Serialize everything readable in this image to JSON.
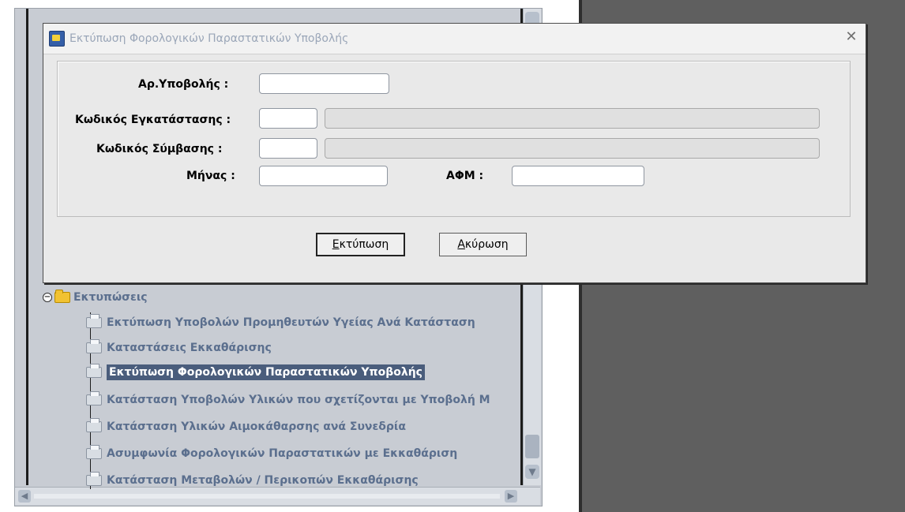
{
  "dialog": {
    "title": "Εκτύπωση Φορολογικών Παραστατικών Υποβολής",
    "close": "✕",
    "fields": {
      "submission_no_label": "Αρ.Υποβολής :",
      "installation_code_label": "Κωδικός Εγκατάστασης :",
      "contract_code_label": "Κωδικός Σύμβασης :",
      "month_label": "Μήνας :",
      "afm_label": "ΑΦΜ :"
    },
    "buttons": {
      "print_first": "Ε",
      "print_rest": "κτύπωση",
      "cancel_first": "Α",
      "cancel_rest": "κύρωση"
    }
  },
  "tree": {
    "root": "Εκτυπώσεις",
    "items": [
      "Εκτύπωση Υποβολών Προμηθευτών Υγείας Ανά Κατάσταση",
      "Καταστάσεις Εκκαθάρισης",
      "Εκτύπωση Φορολογικών Παραστατικών Υποβολής",
      "Κατάσταση Υποβολών Υλικών που σχετίζονται με Υποβολή Μ",
      "Κατάσταση Υλικών Αιμοκάθαρσης ανά Συνεδρία",
      "Ασυμφωνία Φορολογικών Παραστατικών με Εκκαθάριση",
      "Κατάσταση Μεταβολών / Περικοπών Εκκαθάρισης"
    ],
    "selected_index": 2
  },
  "colors": {
    "tree_text": "#5b6f8e",
    "selection": "#4a5d7c",
    "desktop": "#5f5f5f"
  }
}
